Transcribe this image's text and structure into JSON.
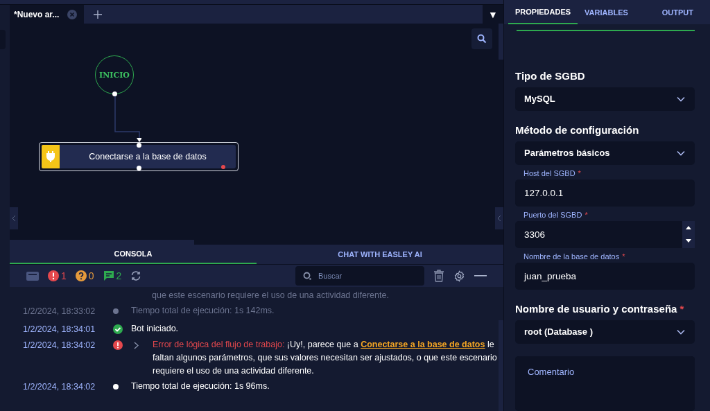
{
  "editor_tabs": [
    {
      "label": "*Nuevo ar...",
      "selected": true
    }
  ],
  "dropdown_toggle": "▼",
  "canvas": {
    "start_node": {
      "label": "INICIO"
    },
    "activity_node": {
      "label": "Conectarse a la base de datos",
      "selected": true,
      "error": true
    }
  },
  "console": {
    "tabs": [
      {
        "label": "CONSOLA",
        "selected": true
      },
      {
        "label": "CHAT WITH EASLEY AI",
        "selected": false
      }
    ],
    "counters": [
      {
        "kind": "error",
        "count": "1"
      },
      {
        "kind": "warning",
        "count": "0"
      },
      {
        "kind": "message",
        "count": "2"
      }
    ],
    "search": {
      "placeholder": "Buscar"
    },
    "log": [
      {
        "kind": "continuation",
        "faded": true,
        "text": "que este escenario requiere el uso de una actividad diferente."
      },
      {
        "kind": "info",
        "faded": true,
        "time": "1/2/2024, 18:33:02",
        "text": "Tiempo total de ejecución: 1s 142ms."
      },
      {
        "kind": "success",
        "faded": false,
        "time": "1/2/2024, 18:34:01",
        "text": "Bot iniciado."
      },
      {
        "kind": "error",
        "faded": false,
        "time": "1/2/2024, 18:34:02",
        "prefix": "Error de lógica del flujo de trabajo:",
        "before": "¡Uy!, parece que a",
        "link": "Conectarse a la base de datos",
        "after": "le faltan algunos parámetros, que sus valores necesitan ser ajustados, o que este escenario requiere el uso de una actividad diferente."
      },
      {
        "kind": "info",
        "faded": false,
        "time": "1/2/2024, 18:34:02",
        "text": "Tiempo total de ejecución: 1s 96ms."
      }
    ]
  },
  "properties": {
    "tabs": [
      {
        "label": "PROPIEDADES",
        "selected": true
      },
      {
        "label": "VARIABLES",
        "selected": false
      },
      {
        "label": "OUTPUT",
        "selected": false
      }
    ],
    "items": [
      {
        "kind": "heading",
        "label": "Tipo de SGBD"
      },
      {
        "kind": "select",
        "value": "MySQL"
      },
      {
        "kind": "heading",
        "label": "Método de configuración"
      },
      {
        "kind": "select",
        "value": "Parámetros básicos"
      },
      {
        "kind": "field",
        "label": "Host del SGBD",
        "required_mark": "*",
        "value": "127.0.0.1"
      },
      {
        "kind": "number",
        "label": "Puerto del SGBD",
        "required_mark": "*",
        "value": "3306"
      },
      {
        "kind": "field",
        "label": "Nombre de la base de datos",
        "required_mark": "*",
        "value": "juan_prueba"
      },
      {
        "kind": "heading",
        "label": "Nombre de usuario y contraseña",
        "required_mark": "*"
      },
      {
        "kind": "select",
        "value": "root (Database )"
      },
      {
        "kind": "textarea",
        "placeholder": "Comentario"
      }
    ]
  }
}
